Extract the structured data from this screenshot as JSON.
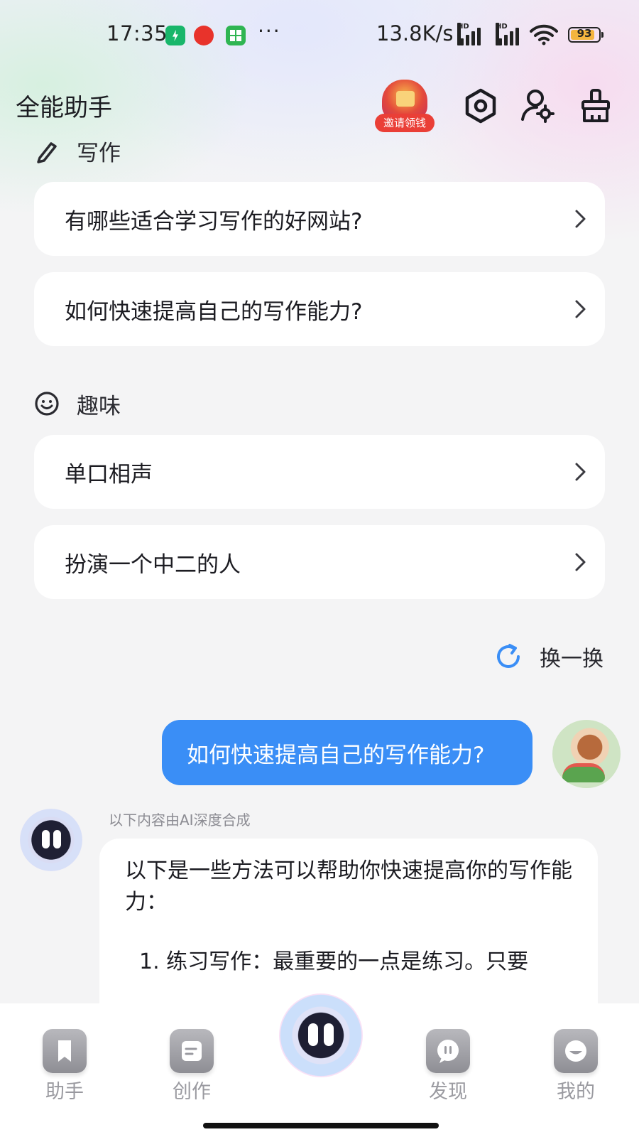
{
  "status_bar": {
    "time": "17:35",
    "more": "···",
    "net_speed": "13.8K/s",
    "signal_tag": "HD",
    "battery_percent": 93
  },
  "header": {
    "title": "全能助手",
    "invite_label": "邀请领钱",
    "icons": [
      "hexagon-settings-icon",
      "user-settings-icon",
      "broom-clean-icon"
    ]
  },
  "sections": [
    {
      "label": "写作",
      "icon": "pencil-icon",
      "items": [
        "有哪些适合学习写作的好网站?",
        "如何快速提高自己的写作能力?"
      ]
    },
    {
      "label": "趣味",
      "icon": "smile-icon",
      "items": [
        "单口相声",
        "扮演一个中二的人"
      ]
    }
  ],
  "refresh_label": "换一换",
  "chat": {
    "user_message": "如何快速提高自己的写作能力?",
    "ai_note": "以下内容由AI深度合成",
    "ai_intro": "以下是一些方法可以帮助你快速提高你的写作能力：",
    "ai_item_1": "1. 练习写作：最重要的一点是练习。只要"
  },
  "bottom_nav": {
    "items": [
      "助手",
      "创作",
      "发现",
      "我的"
    ]
  },
  "colors": {
    "accent_blue": "#3a8ef6",
    "invite_red": "#ea3f37",
    "battery_yellow": "#f4b53e"
  }
}
